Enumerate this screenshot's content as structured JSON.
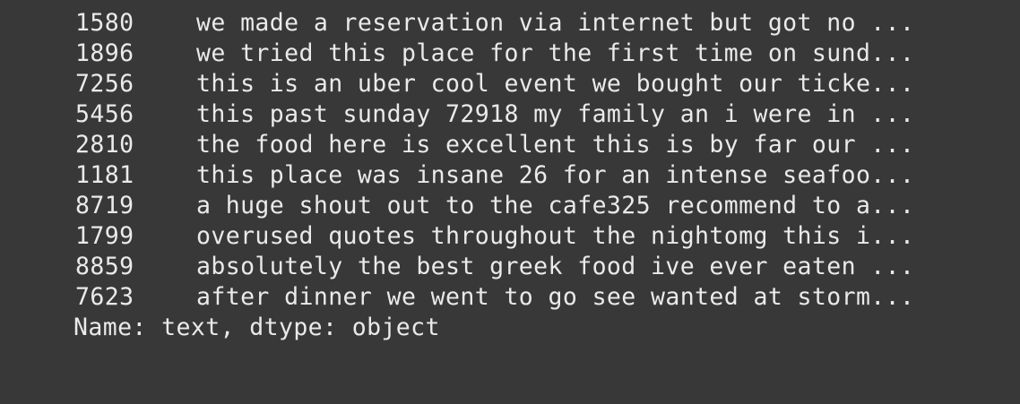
{
  "series_output": {
    "rows": [
      {
        "index": "1580",
        "text": "we made a reservation via internet but got no ..."
      },
      {
        "index": "1896",
        "text": "we tried this place for the first time on sund..."
      },
      {
        "index": "7256",
        "text": "this is an uber cool event we bought our ticke..."
      },
      {
        "index": "5456",
        "text": "this past sunday 72918 my family an i were in ..."
      },
      {
        "index": "2810",
        "text": "the food here is excellent this is by far our ..."
      },
      {
        "index": "1181",
        "text": "this place was insane 26 for an intense seafoo..."
      },
      {
        "index": "8719",
        "text": "a huge shout out to the cafe325 recommend to a..."
      },
      {
        "index": "1799",
        "text": "overused quotes throughout the nightomg this i..."
      },
      {
        "index": "8859",
        "text": "absolutely the best greek food ive ever eaten ..."
      },
      {
        "index": "7623",
        "text": "after dinner we went to go see wanted at storm..."
      }
    ],
    "footer": "Name: text, dtype: object"
  },
  "colors": {
    "background": "#383838",
    "text": "#eaeaea"
  }
}
